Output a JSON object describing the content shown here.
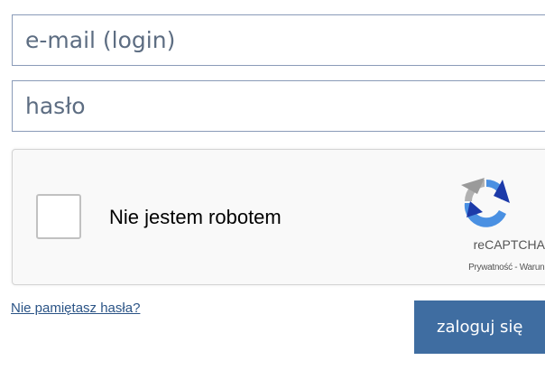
{
  "login_form": {
    "email_placeholder": "e-mail (login)",
    "password_placeholder": "hasło"
  },
  "captcha": {
    "label": "Nie jestem robotem",
    "brand": "reCAPTCHA",
    "links": "Prywatność - Warunki",
    "checked": false,
    "logo_icon": "recaptcha-logo-icon",
    "colors": {
      "blue": "#4a90e2",
      "dark_blue": "#1c3aa9",
      "gray": "#b1b1b1"
    }
  },
  "forgot_password": {
    "label": "Nie pamiętasz hasła?"
  },
  "login_button": {
    "label": "zaloguj się",
    "color": "#3f6da1"
  }
}
